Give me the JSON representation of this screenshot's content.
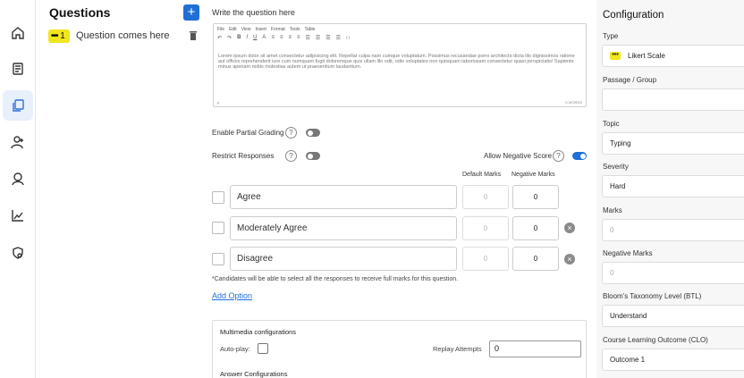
{
  "rail": {
    "items": [
      {
        "icon": "home-icon",
        "active": false
      },
      {
        "icon": "courses-icon",
        "active": false
      },
      {
        "icon": "questions-icon",
        "active": true
      },
      {
        "icon": "add-user-icon",
        "active": false
      },
      {
        "icon": "user-icon",
        "active": false
      },
      {
        "icon": "analytics-icon",
        "active": false
      },
      {
        "icon": "settings-shield-icon",
        "active": false
      }
    ]
  },
  "questions": {
    "title": "Questions",
    "add_label": "+",
    "items": [
      {
        "number": "1",
        "badge_dots": "•••",
        "text": "Question comes here"
      }
    ]
  },
  "editor": {
    "prompt": "Write the question here",
    "menu": [
      "File",
      "Edit",
      "View",
      "Insert",
      "Format",
      "Tools",
      "Table"
    ],
    "toolbar": [
      "↶",
      "↷",
      "B",
      "I",
      "U",
      "A",
      "≡",
      "≡",
      "≡",
      "≡",
      "☰",
      "☰",
      "☰",
      "☰",
      "∷"
    ],
    "body": "Lorem ipsum dolor sit amet consectetur adipisicing elit. Repellat culpa nam cumque voluptatum. Possimus recusandae porro architecto dicta illo dignissimos ratione aut officiis reprehenderit iure cum numquam fugit doloremque quis ullam illo odit, odio voluptates non quisquam laboriosam consectetur quasi perspiciatis! Sapiente minus aperiam nobis molestias autem ut praesentium laudantium.",
    "status_left": "p",
    "status_right": "0 WORDS"
  },
  "settings": {
    "partial_grading_label": "Enable Partial Grading",
    "partial_grading_on": false,
    "restrict_responses_label": "Restrict Responses",
    "restrict_responses_on": false,
    "negative_score_label": "Allow Negative Score",
    "negative_score_on": true,
    "help_glyph": "?"
  },
  "options": {
    "col_default": "Default Marks",
    "col_negative": "Negative Marks",
    "remove_glyph": "×",
    "items": [
      {
        "text": "Agree",
        "default_marks": "0",
        "negative_marks": "0",
        "removable": false
      },
      {
        "text": "Moderately Agree",
        "default_marks": "0",
        "negative_marks": "0",
        "removable": true
      },
      {
        "text": "Disagree",
        "default_marks": "0",
        "negative_marks": "0",
        "removable": true
      }
    ],
    "note": "*Candidates will be able to select all the responses to receive full marks for this question.",
    "add_option": "Add Option"
  },
  "multimedia": {
    "title": "Multimedia configurations",
    "autoplay_label": "Auto-play:",
    "replay_label": "Replay Attempts",
    "replay_value": "0",
    "answer_title": "Answer Configurations"
  },
  "config": {
    "title": "Configuration",
    "type_label": "Type",
    "type_badge": "•••",
    "type_value": "Likert Scale",
    "passage_label": "Passage / Group",
    "passage_value": "",
    "topic_label": "Topic",
    "topic_value": "Typing",
    "severity_label": "Severity",
    "severity_value": "Hard",
    "marks_label": "Marks",
    "marks_value": "0",
    "neg_marks_label": "Negative Marks",
    "neg_marks_value": "0",
    "btl_label": "Bloom's Taxonomy Level (BTL)",
    "btl_value": "Understand",
    "clo_label": "Course Learning Outcome (CLO)",
    "clo_value": "Outcome 1"
  },
  "colors": {
    "accent": "#1f6fd6",
    "badge": "#f0e61e",
    "panel_bg": "#f7f7f7"
  }
}
